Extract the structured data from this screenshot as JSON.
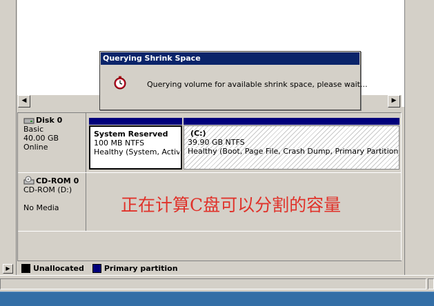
{
  "dialog": {
    "title": "Querying Shrink Space",
    "message": "Querying volume for available shrink space, please wait...",
    "icon": "stopwatch-icon"
  },
  "disks": [
    {
      "name": "Disk 0",
      "type": "Basic",
      "size": "40.00 GB",
      "status": "Online",
      "icon": "hard-disk-icon",
      "partitions": [
        {
          "name": "System Reserved",
          "size": "100 MB NTFS",
          "status": "Healthy (System, Active,"
        },
        {
          "name": "(C:)",
          "size": "39.90 GB NTFS",
          "status": "Healthy (Boot, Page File, Crash Dump, Primary Partition)"
        }
      ]
    },
    {
      "name": "CD-ROM 0",
      "type": "CD-ROM (D:)",
      "status": "No Media",
      "icon": "cdrom-icon"
    }
  ],
  "annotation": "正在计算C盘可以分割的容量",
  "legend": [
    {
      "label": "Unallocated",
      "color": "#000000"
    },
    {
      "label": "Primary partition",
      "color": "#00007b"
    }
  ],
  "colors": {
    "partition_bar": "#00007b",
    "title_bar": "#0a246a",
    "annotation": "#e0322a"
  }
}
